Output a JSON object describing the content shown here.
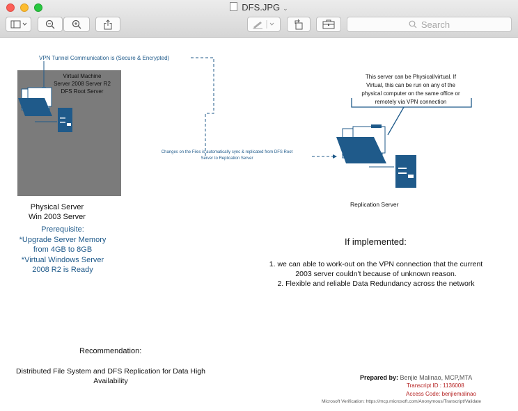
{
  "window": {
    "title": "DFS.JPG"
  },
  "toolbar": {
    "search_placeholder": "Search"
  },
  "colors": {
    "accent": "#1f5a8a",
    "note_red": "#b42020",
    "gray_panel": "#7b7b7b"
  },
  "diagram": {
    "vpn_label": "VPN Tunnel Communication is (Secure & Encrypted)",
    "vm_label": [
      "Virtual Machine",
      "Server 2008 Server R2",
      "DFS Root Server"
    ],
    "sync_label": [
      "Changes on the Files is automatically sync & replicated from DFS Root",
      "Server to Replication Server"
    ],
    "replication_note": [
      "This server can be Physical/virtual. If",
      "Virtual, this can be run on any of the",
      "physical computer  on the same office or",
      "remotely via  VPN  connection"
    ],
    "replication_label": "Replication Server",
    "physical_label": [
      "Physical Server",
      "Win 2003 Server"
    ],
    "prereq": [
      "Prerequisite:",
      "*Upgrade Server Memory",
      "from 4GB to 8GB",
      "*Virtual Windows Server",
      "2008 R2 is Ready"
    ]
  },
  "implemented": {
    "heading": "If implemented:",
    "points": [
      "1. we can able to work-out on the VPN connection that the current",
      "2003 server couldn't because of unknown reason.",
      "2. Flexible and reliable Data Redundancy across the network"
    ]
  },
  "recommendation": {
    "heading": "Recommendation:",
    "body": [
      "Distributed File System and DFS Replication for Data High",
      "Availability"
    ]
  },
  "credits": {
    "prepared_by_label": "Prepared by:",
    "prepared_by_name": "Benjie Malinao, MCP,MTA",
    "transcript": "Transcript ID  : 1136008",
    "access": "Access Code: benjiemalinao",
    "verification": "Microsoft Verification: https://mcp.microsoft.com/Anonymous/Transcript/Validate"
  }
}
